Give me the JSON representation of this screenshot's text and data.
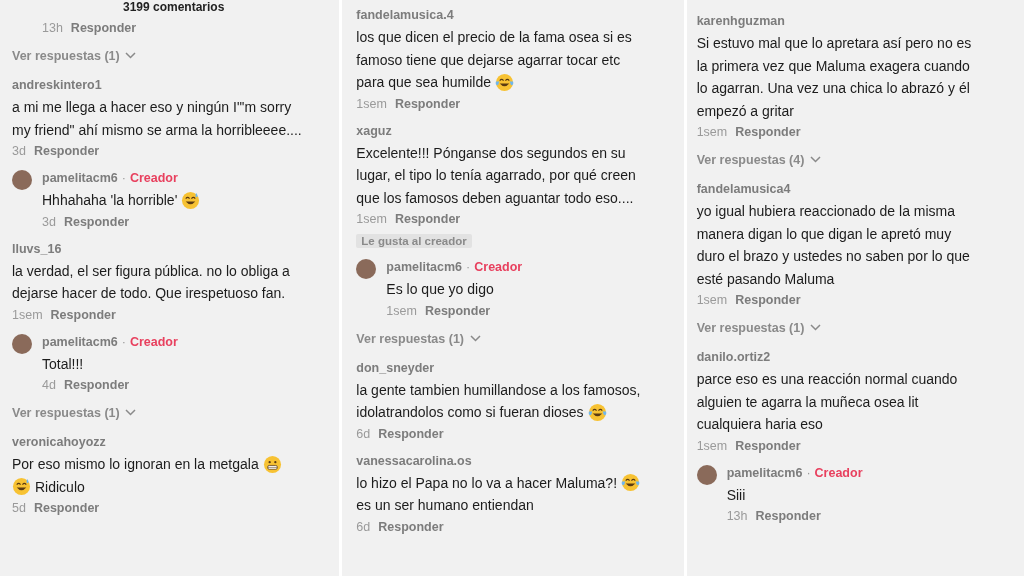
{
  "panels": [
    {
      "items": [
        {
          "kind": "header",
          "text": "3199 comentarios"
        },
        {
          "kind": "reply",
          "time": "13h",
          "action": "Responder"
        },
        {
          "kind": "more",
          "text": "Ver respuestas (1)"
        },
        {
          "kind": "comment",
          "user": "andreskintero1",
          "lines": [
            [
              {
                "kind": "text",
                "text": "a mi me llega a hacer eso y ningún I\"'m sorry"
              }
            ],
            [
              {
                "kind": "text",
                "text": "my friend\" ahí mismo se arma la horribleeee...."
              }
            ]
          ],
          "time": "3d",
          "action": "Responder"
        },
        {
          "kind": "reply",
          "user": "pamelitacm6",
          "separator": "·",
          "badge": "Creador",
          "lines": [
            [
              {
                "kind": "text",
                "text": "Hhhahaha 'la horrible'"
              },
              {
                "kind": "sweat-smile"
              }
            ]
          ],
          "time": "3d",
          "action": "Responder"
        },
        {
          "kind": "comment",
          "user": "lluvs_16",
          "lines": [
            [
              {
                "kind": "text",
                "text": "la verdad, el ser figura pública. no lo obliga a"
              }
            ],
            [
              {
                "kind": "text",
                "text": "dejarse hacer de todo. Que irespetuoso fan."
              }
            ]
          ],
          "time": "1sem",
          "action": "Responder"
        },
        {
          "kind": "reply",
          "user": "pamelitacm6",
          "separator": "·",
          "badge": "Creador",
          "lines": [
            [
              {
                "kind": "text",
                "text": "Total!!!"
              }
            ]
          ],
          "time": "4d",
          "action": "Responder"
        },
        {
          "kind": "more",
          "text": "Ver respuestas (1)"
        },
        {
          "kind": "comment",
          "user": "veronicahoyozz",
          "lines": [
            [
              {
                "kind": "text",
                "text": "Por eso mismo lo ignoran en la metgala"
              },
              {
                "kind": "grimace"
              }
            ],
            [
              {
                "kind": "sweat-smile"
              },
              {
                "kind": "text",
                "text": "Ridiculo"
              }
            ]
          ],
          "time": "5d",
          "action": "Responder"
        }
      ]
    },
    {
      "items": [
        {
          "kind": "comment",
          "user": "fandelamusica.4",
          "lines": [
            [
              {
                "kind": "text",
                "text": "los que dicen el precio de la fama osea si es"
              }
            ],
            [
              {
                "kind": "text",
                "text": "famoso tiene que dejarse agarrar tocar etc"
              }
            ],
            [
              {
                "kind": "text",
                "text": "para que sea humilde"
              },
              {
                "kind": "joy"
              }
            ]
          ],
          "time": "1sem",
          "action": "Responder"
        },
        {
          "kind": "comment",
          "user": "xaguz",
          "lines": [
            [
              {
                "kind": "text",
                "text": "Excelente!!! Pónganse dos segundos en su"
              }
            ],
            [
              {
                "kind": "text",
                "text": "lugar, el tipo lo tenía agarrado, por qué creen"
              }
            ],
            [
              {
                "kind": "text",
                "text": "que los famosos deben aguantar todo eso...."
              }
            ]
          ],
          "time": "1sem",
          "action": "Responder",
          "liked": "Le gusta al creador"
        },
        {
          "kind": "reply",
          "user": "pamelitacm6",
          "separator": "·",
          "badge": "Creador",
          "lines": [
            [
              {
                "kind": "text",
                "text": "Es lo que yo digo"
              }
            ]
          ],
          "time": "1sem",
          "action": "Responder"
        },
        {
          "kind": "more",
          "text": "Ver respuestas (1)"
        },
        {
          "kind": "comment",
          "user": "don_sneyder",
          "lines": [
            [
              {
                "kind": "text",
                "text": "la gente tambien humillandose a los famosos,"
              }
            ],
            [
              {
                "kind": "text",
                "text": "idolatrandolos como si fueran dioses"
              },
              {
                "kind": "joy"
              }
            ]
          ],
          "time": "6d",
          "action": "Responder"
        },
        {
          "kind": "comment",
          "user": "vanessacarolina.os",
          "lines": [
            [
              {
                "kind": "text",
                "text": "lo hizo el Papa no lo va a hacer Maluma?!"
              },
              {
                "kind": "joy"
              }
            ],
            [
              {
                "kind": "text",
                "text": "es un ser humano entiendan"
              }
            ]
          ],
          "time": "6d",
          "action": "Responder"
        }
      ]
    },
    {
      "items": [
        {
          "kind": "comment",
          "user": "karenhguzman",
          "lines": [
            [
              {
                "kind": "text",
                "text": "Si estuvo mal que lo apretara así pero no es"
              }
            ],
            [
              {
                "kind": "text",
                "text": "la primera vez que Maluma exagera cuando"
              }
            ],
            [
              {
                "kind": "text",
                "text": "lo agarran. Una vez una chica lo abrazó y él"
              }
            ],
            [
              {
                "kind": "text",
                "text": "empezó a gritar"
              }
            ]
          ],
          "time": "1sem",
          "action": "Responder"
        },
        {
          "kind": "more",
          "text": "Ver respuestas (4)"
        },
        {
          "kind": "comment",
          "user": "fandelamusica4",
          "lines": [
            [
              {
                "kind": "text",
                "text": "yo igual hubiera reaccionado de la misma"
              }
            ],
            [
              {
                "kind": "text",
                "text": "manera digan lo que digan le apretó muy"
              }
            ],
            [
              {
                "kind": "text",
                "text": "duro el brazo y ustedes no saben por lo que"
              }
            ],
            [
              {
                "kind": "text",
                "text": "esté pasando Maluma"
              }
            ]
          ],
          "time": "1sem",
          "action": "Responder"
        },
        {
          "kind": "more",
          "text": "Ver respuestas (1)"
        },
        {
          "kind": "comment",
          "user": "danilo.ortiz2",
          "lines": [
            [
              {
                "kind": "text",
                "text": "parce eso es una reacción normal cuando"
              }
            ],
            [
              {
                "kind": "text",
                "text": "alguien te agarra la muñeca osea lit"
              }
            ],
            [
              {
                "kind": "text",
                "text": "cualquiera haria eso"
              }
            ]
          ],
          "time": "1sem",
          "action": "Responder"
        },
        {
          "kind": "reply",
          "user": "pamelitacm6",
          "separator": "·",
          "badge": "Creador",
          "lines": [
            [
              {
                "kind": "text",
                "text": "Siii"
              }
            ]
          ],
          "time": "13h",
          "action": "Responder"
        }
      ]
    }
  ]
}
